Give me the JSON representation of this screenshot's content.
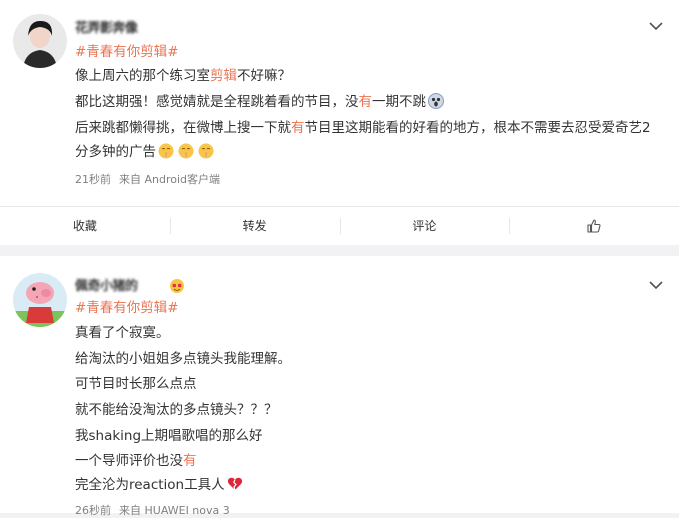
{
  "post1": {
    "user_name": "花弄影奔像",
    "hashtag": "#青春有你剪辑#",
    "lines": [
      {
        "a": "像上周六的那个练习室",
        "hl": "剪辑",
        "b": "不好嘛？"
      },
      {
        "a": "都比这期强！感觉婧就是全程跳着看的节目，没",
        "hl": "有",
        "b": "一期不跳"
      },
      {
        "a": "后来跳都懒得挑，在微博上搜一下就",
        "hl": "有",
        "b": "节目里这期能看的好看的地方，根本不需要去忍受爱奇艺2"
      },
      {
        "a": "分多钟的广告",
        "hl": "",
        "b": ""
      }
    ],
    "time": "21秒前",
    "source": "来自 Android客户端",
    "actions": {
      "collect": "收藏",
      "repost": "转发",
      "comment": "评论"
    }
  },
  "post2": {
    "user_name": "佩奇小猪的",
    "hashtag": "#青春有你剪辑#",
    "lines": [
      {
        "a": "真看了个寂寞。",
        "hl": "",
        "b": ""
      },
      {
        "a": "给淘汰的小姐姐多点镜头我能理解。",
        "hl": "",
        "b": ""
      },
      {
        "a": "可节目时长那么点点",
        "hl": "",
        "b": ""
      },
      {
        "a": "就不能给没淘汰的多点镜头？？？",
        "hl": "",
        "b": ""
      },
      {
        "a": "我shaking上期唱歌唱的那么好",
        "hl": "",
        "b": ""
      },
      {
        "a": "一个导师评价也没",
        "hl": "有",
        "b": ""
      },
      {
        "a": "完全沦为reaction工具人",
        "hl": "",
        "b": ""
      }
    ],
    "time": "26秒前",
    "source": "来自 HUAWEI nova 3"
  },
  "icons": [
    "chevron-down-icon",
    "like-icon",
    "shush-emoji-icon",
    "screaming-emoji-icon",
    "broken-heart-icon",
    "heart-eyes-badge-icon"
  ],
  "colors": {
    "accent": "#eb7350",
    "meta": "#808080",
    "divider": "#e6e6e6",
    "page_bg": "#f2f2f5"
  }
}
